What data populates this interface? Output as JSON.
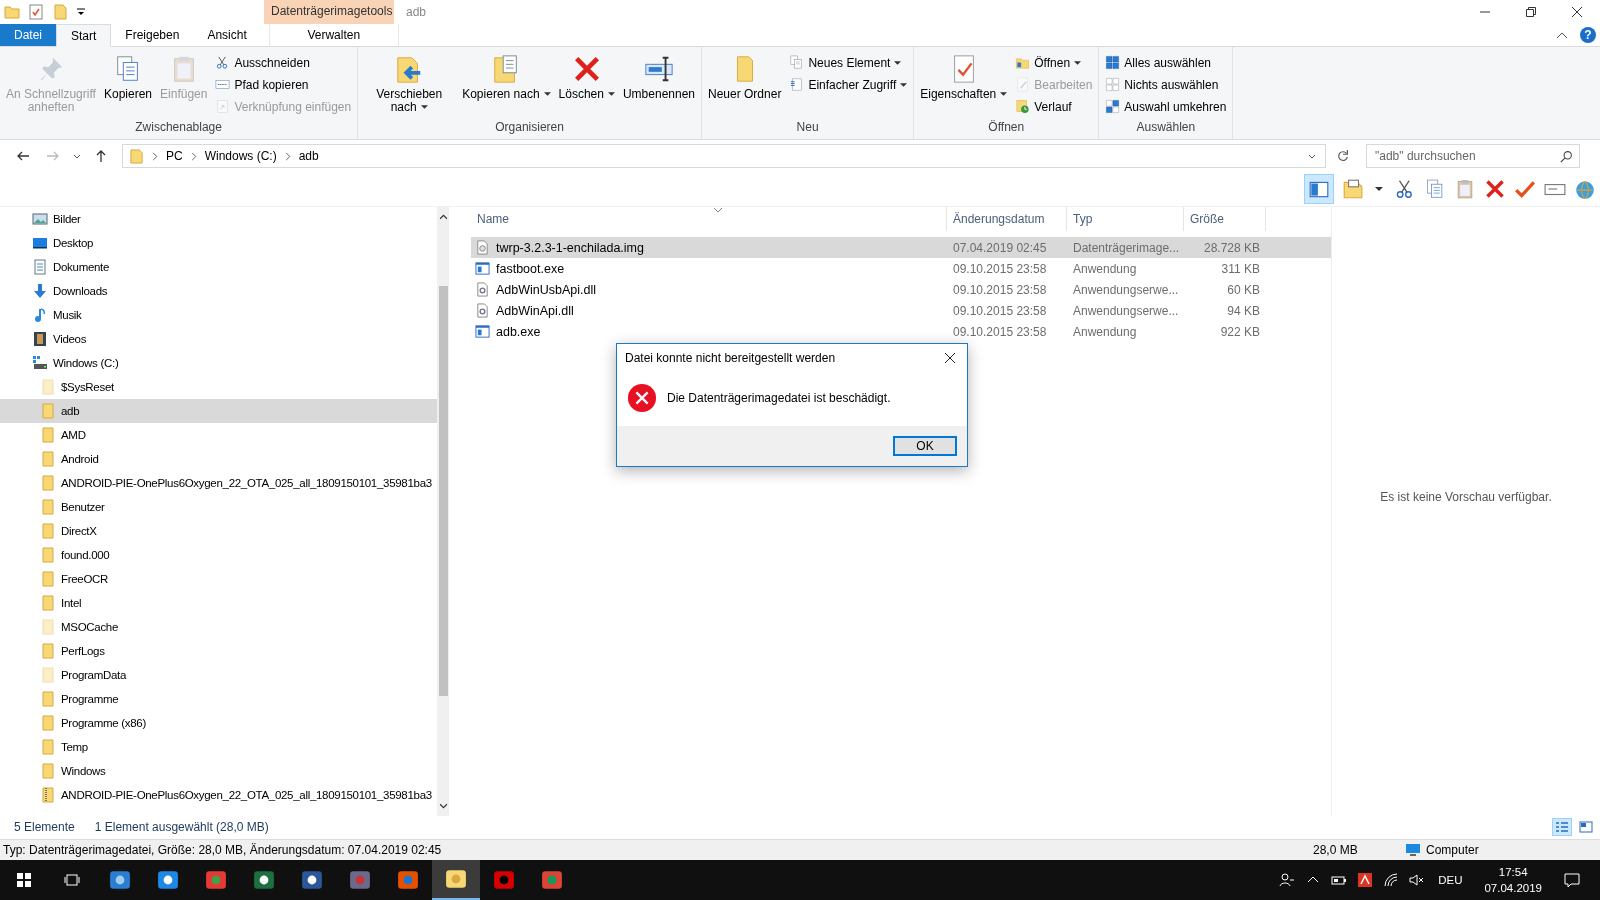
{
  "window": {
    "title": "adb",
    "context_tab": "Datenträgerimagetools",
    "help": "?"
  },
  "ribbon_tabs": [
    {
      "label": "Datei",
      "kind": "file",
      "selected": false
    },
    {
      "label": "Start",
      "kind": "tab",
      "selected": true
    },
    {
      "label": "Freigeben",
      "kind": "tab",
      "selected": false
    },
    {
      "label": "Ansicht",
      "kind": "tab",
      "selected": false
    },
    {
      "label": "Verwalten",
      "kind": "context",
      "selected": false
    }
  ],
  "ribbon_groups": [
    {
      "label": "Zwischenablage",
      "items": [
        {
          "label": "An Schnellzugriff anheften",
          "kind": "large",
          "disabled": true,
          "dropdown": false
        },
        {
          "label": "Kopieren",
          "kind": "large",
          "disabled": false,
          "dropdown": false
        },
        {
          "label": "Einfügen",
          "kind": "large",
          "disabled": true,
          "dropdown": false
        },
        {
          "label": "Ausschneiden",
          "kind": "small",
          "disabled": false,
          "dropdown": false
        },
        {
          "label": "Pfad kopieren",
          "kind": "small",
          "disabled": false,
          "dropdown": false
        },
        {
          "label": "Verknüpfung einfügen",
          "kind": "small",
          "disabled": true,
          "dropdown": false
        }
      ]
    },
    {
      "label": "Organisieren",
      "items": [
        {
          "label": "Verschieben nach",
          "kind": "large",
          "disabled": false,
          "dropdown": true
        },
        {
          "label": "Kopieren nach",
          "kind": "large",
          "disabled": false,
          "dropdown": true
        },
        {
          "label": "Löschen",
          "kind": "large",
          "disabled": false,
          "dropdown": true
        },
        {
          "label": "Umbenennen",
          "kind": "large",
          "disabled": false,
          "dropdown": false
        }
      ]
    },
    {
      "label": "Neu",
      "items": [
        {
          "label": "Neuer Ordner",
          "kind": "large",
          "disabled": false,
          "dropdown": false
        },
        {
          "label": "Neues Element",
          "kind": "small",
          "disabled": false,
          "dropdown": true
        },
        {
          "label": "Einfacher Zugriff",
          "kind": "small",
          "disabled": false,
          "dropdown": true
        }
      ]
    },
    {
      "label": "Öffnen",
      "items": [
        {
          "label": "Eigenschaften",
          "kind": "large",
          "disabled": false,
          "dropdown": true
        },
        {
          "label": "Öffnen",
          "kind": "small",
          "disabled": false,
          "dropdown": true
        },
        {
          "label": "Bearbeiten",
          "kind": "small",
          "disabled": true,
          "dropdown": false
        },
        {
          "label": "Verlauf",
          "kind": "small",
          "disabled": false,
          "dropdown": false
        }
      ]
    },
    {
      "label": "Auswählen",
      "items": [
        {
          "label": "Alles auswählen",
          "kind": "small",
          "disabled": false,
          "dropdown": false
        },
        {
          "label": "Nichts auswählen",
          "kind": "small",
          "disabled": false,
          "dropdown": false
        },
        {
          "label": "Auswahl umkehren",
          "kind": "small",
          "disabled": false,
          "dropdown": false
        }
      ]
    }
  ],
  "address": {
    "path": [
      "PC",
      "Windows (C:)",
      "adb"
    ],
    "search": {
      "placeholder": "\"adb\" durchsuchen"
    }
  },
  "tree": [
    {
      "label": "Bilder",
      "kind": "library",
      "selected": false
    },
    {
      "label": "Desktop",
      "kind": "library",
      "selected": false
    },
    {
      "label": "Dokumente",
      "kind": "library",
      "selected": false
    },
    {
      "label": "Downloads",
      "kind": "library",
      "selected": false
    },
    {
      "label": "Musik",
      "kind": "library",
      "selected": false
    },
    {
      "label": "Videos",
      "kind": "library",
      "selected": false
    },
    {
      "label": "Windows (C:)",
      "kind": "drive",
      "selected": false,
      "children": [
        {
          "label": "$SysReset",
          "kind": "folder",
          "hidden": true,
          "selected": false
        },
        {
          "label": "adb",
          "kind": "folder",
          "hidden": false,
          "selected": true
        },
        {
          "label": "AMD",
          "kind": "folder",
          "hidden": false,
          "selected": false
        },
        {
          "label": "Android",
          "kind": "folder",
          "hidden": false,
          "selected": false
        },
        {
          "label": "ANDROID-PIE-OnePlus6Oxygen_22_OTA_025_all_1809150101_35981ba3",
          "kind": "folder",
          "hidden": false,
          "selected": false
        },
        {
          "label": "Benutzer",
          "kind": "folder",
          "hidden": false,
          "selected": false
        },
        {
          "label": "DirectX",
          "kind": "folder",
          "hidden": false,
          "selected": false
        },
        {
          "label": "found.000",
          "kind": "folder",
          "hidden": false,
          "selected": false
        },
        {
          "label": "FreeOCR",
          "kind": "folder",
          "hidden": false,
          "selected": false
        },
        {
          "label": "Intel",
          "kind": "folder",
          "hidden": false,
          "selected": false
        },
        {
          "label": "MSOCache",
          "kind": "folder",
          "hidden": true,
          "selected": false
        },
        {
          "label": "PerfLogs",
          "kind": "folder",
          "hidden": false,
          "selected": false
        },
        {
          "label": "ProgramData",
          "kind": "folder",
          "hidden": true,
          "selected": false
        },
        {
          "label": "Programme",
          "kind": "folder",
          "hidden": false,
          "selected": false
        },
        {
          "label": "Programme (x86)",
          "kind": "folder",
          "hidden": false,
          "selected": false
        },
        {
          "label": "Temp",
          "kind": "folder",
          "hidden": false,
          "selected": false
        },
        {
          "label": "Windows",
          "kind": "folder",
          "hidden": false,
          "selected": false
        },
        {
          "label": "ANDROID-PIE-OnePlus6Oxygen_22_OTA_025_all_1809150101_35981ba3",
          "kind": "zip",
          "hidden": false,
          "selected": false
        }
      ]
    }
  ],
  "files": {
    "columns": [
      "Name",
      "Änderungsdatum",
      "Typ",
      "Größe"
    ],
    "rows": [
      {
        "name": "twrp-3.2.3-1-enchilada.img",
        "date": "07.04.2019 02:45",
        "type": "Datenträgerimage...",
        "size": "28.728 KB",
        "kind": "disk-image",
        "selected": true
      },
      {
        "name": "fastboot.exe",
        "date": "09.10.2015 23:58",
        "type": "Anwendung",
        "size": "311 KB",
        "kind": "application",
        "selected": false
      },
      {
        "name": "AdbWinUsbApi.dll",
        "date": "09.10.2015 23:58",
        "type": "Anwendungserwe...",
        "size": "60 KB",
        "kind": "extension",
        "selected": false
      },
      {
        "name": "AdbWinApi.dll",
        "date": "09.10.2015 23:58",
        "type": "Anwendungserwe...",
        "size": "94 KB",
        "kind": "extension",
        "selected": false
      },
      {
        "name": "adb.exe",
        "date": "09.10.2015 23:58",
        "type": "Anwendung",
        "size": "922 KB",
        "kind": "application",
        "selected": false
      }
    ]
  },
  "preview": {
    "message": "Es ist keine Vorschau verfügbar."
  },
  "dialog": {
    "title": "Datei konnte nicht bereitgestellt werden",
    "message": "Die Datenträgerimagedatei ist beschädigt.",
    "button": "OK"
  },
  "status_bar": {
    "count": "5 Elemente",
    "selection": "1 Element ausgewählt (28,0 MB)",
    "views": [
      {
        "kind": "details",
        "selected": true
      },
      {
        "kind": "tiles",
        "selected": false
      }
    ]
  },
  "details_bar": {
    "info": "Typ: Datenträgerimagedatei, Größe: 28,0 MB, Änderungsdatum: 07.04.2019 02:45",
    "size": "28,0 MB",
    "zone": "Computer"
  },
  "taskbar": {
    "apps": [
      {
        "selected": false
      },
      {
        "selected": false
      },
      {
        "selected": false
      },
      {
        "selected": false
      },
      {
        "selected": false
      },
      {
        "selected": false
      },
      {
        "selected": false
      },
      {
        "selected": true
      },
      {
        "selected": false
      },
      {
        "selected": false
      }
    ],
    "language": "DEU",
    "time": "17:54",
    "date": "07.04.2019"
  }
}
